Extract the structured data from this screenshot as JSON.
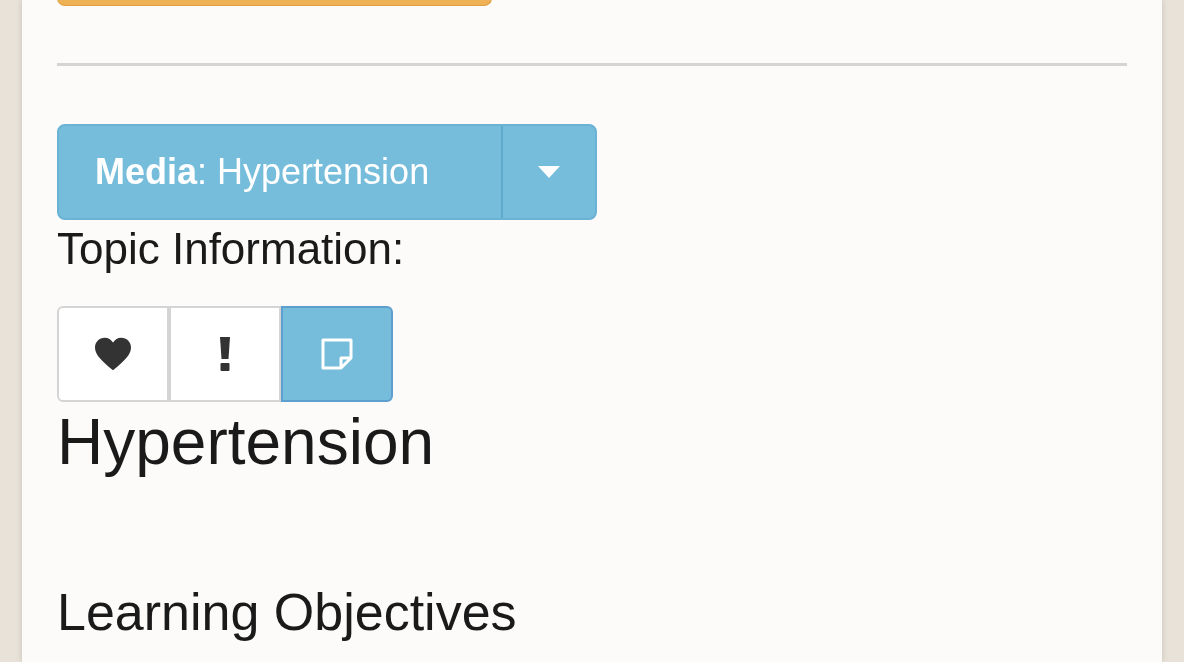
{
  "media_dropdown": {
    "text": "**Media**: Hypertension"
  },
  "topic_label": "Topic Information:",
  "topic_buttons": [
    {
      "kind": "heart",
      "selected": false
    },
    {
      "kind": "alert",
      "selected": false
    },
    {
      "kind": "note",
      "selected": true
    }
  ],
  "title": "Hypertension",
  "section_heading": "Learning Objectives"
}
